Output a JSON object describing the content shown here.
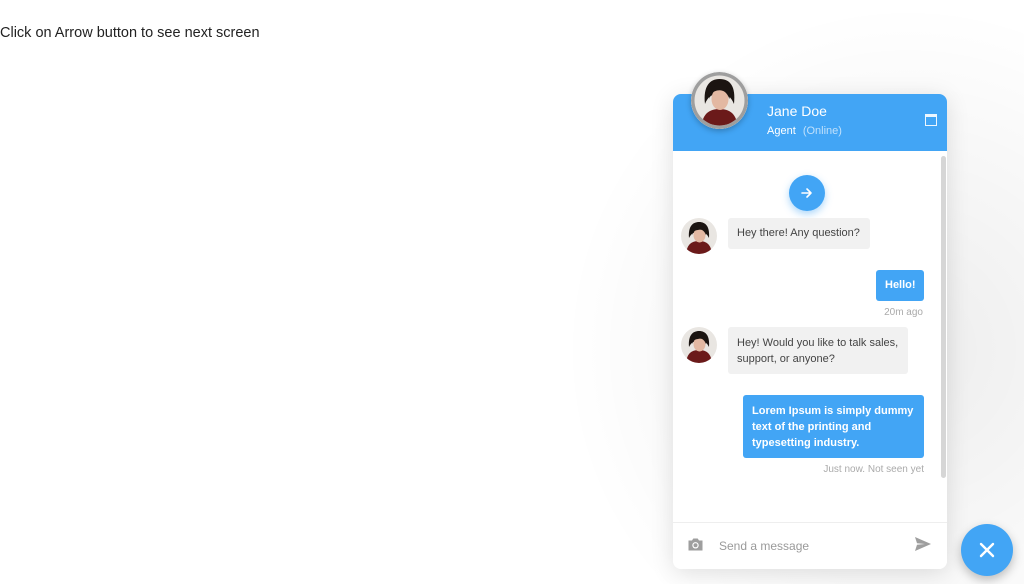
{
  "page": {
    "hint": "Click on Arrow button to see next screen"
  },
  "theme": {
    "accent": "#42a5f5",
    "incoming_bubble": "#f1f1f1"
  },
  "chat": {
    "header": {
      "name": "Jane Doe",
      "role": "Agent",
      "status": "(Online)"
    },
    "messages": [
      {
        "from": "agent",
        "text": "Hey there! Any question?"
      },
      {
        "from": "user",
        "text": "Hello!",
        "meta": "20m ago"
      },
      {
        "from": "agent",
        "text": "Hey! Would you like to talk sales, support, or anyone?"
      },
      {
        "from": "user",
        "text": "Lorem Ipsum is simply dummy text of the printing and typesetting industry.",
        "meta": "Just now. Not seen yet"
      }
    ],
    "composer": {
      "placeholder": "Send a message"
    },
    "icons": {
      "next": "arrow-right-icon",
      "camera": "camera-icon",
      "send": "send-icon",
      "expand": "window-icon",
      "close": "close-icon"
    }
  }
}
